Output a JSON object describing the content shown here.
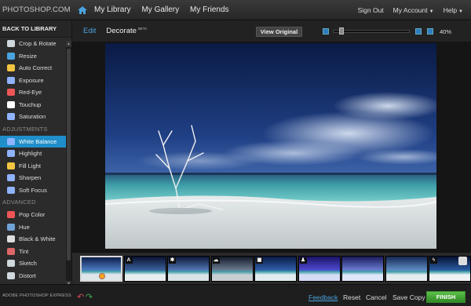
{
  "topbar": {
    "brand": "PHOTOSHOP.COM",
    "nav": [
      "My Library",
      "My Gallery",
      "My Friends"
    ],
    "sign_out": "Sign Out",
    "my_account": "My Account",
    "help": "Help"
  },
  "sidebar": {
    "back": "BACK TO LIBRARY",
    "basics": [
      {
        "label": "Crop & Rotate",
        "icon": "crop-icon"
      },
      {
        "label": "Resize",
        "icon": "resize-icon"
      },
      {
        "label": "Auto Correct",
        "icon": "wand-icon"
      },
      {
        "label": "Exposure",
        "icon": "exposure-icon"
      },
      {
        "label": "Red-Eye",
        "icon": "red-eye-icon"
      },
      {
        "label": "Touchup",
        "icon": "hand-icon"
      },
      {
        "label": "Saturation",
        "icon": "saturation-icon"
      }
    ],
    "adjustments_header": "ADJUSTMENTS",
    "adjustments": [
      {
        "label": "White Balance",
        "icon": "white-balance-icon",
        "active": true
      },
      {
        "label": "Highlight",
        "icon": "highlight-icon"
      },
      {
        "label": "Fill Light",
        "icon": "bulb-icon"
      },
      {
        "label": "Sharpen",
        "icon": "sharpen-icon"
      },
      {
        "label": "Soft Focus",
        "icon": "soft-focus-icon"
      }
    ],
    "advanced_header": "ADVANCED",
    "advanced": [
      {
        "label": "Pop Color",
        "icon": "pop-color-icon"
      },
      {
        "label": "Hue",
        "icon": "hue-icon"
      },
      {
        "label": "Black & White",
        "icon": "bw-icon"
      },
      {
        "label": "Tint",
        "icon": "tint-icon"
      },
      {
        "label": "Sketch",
        "icon": "sketch-icon"
      },
      {
        "label": "Distort",
        "icon": "distort-icon"
      }
    ]
  },
  "subbar": {
    "edit": "Edit",
    "decorate": "Decorate",
    "decorate_badge": "BETA",
    "view_original": "View Original",
    "zoom": "40%",
    "zoom_fraction": 0.07
  },
  "filmstrip": {
    "badges": [
      "",
      "A",
      "*",
      "cloud",
      "img",
      "man",
      "",
      "",
      "bolt"
    ]
  },
  "bottombar": {
    "logo": "ADOBE PHOTOSHOP EXPRESS",
    "feedback": "Feedback",
    "reset": "Reset",
    "cancel": "Cancel",
    "save_copy": "Save Copy",
    "finish": "FINISH"
  },
  "colors": {
    "accent": "#1f8ec9",
    "finish": "#3fa635"
  }
}
